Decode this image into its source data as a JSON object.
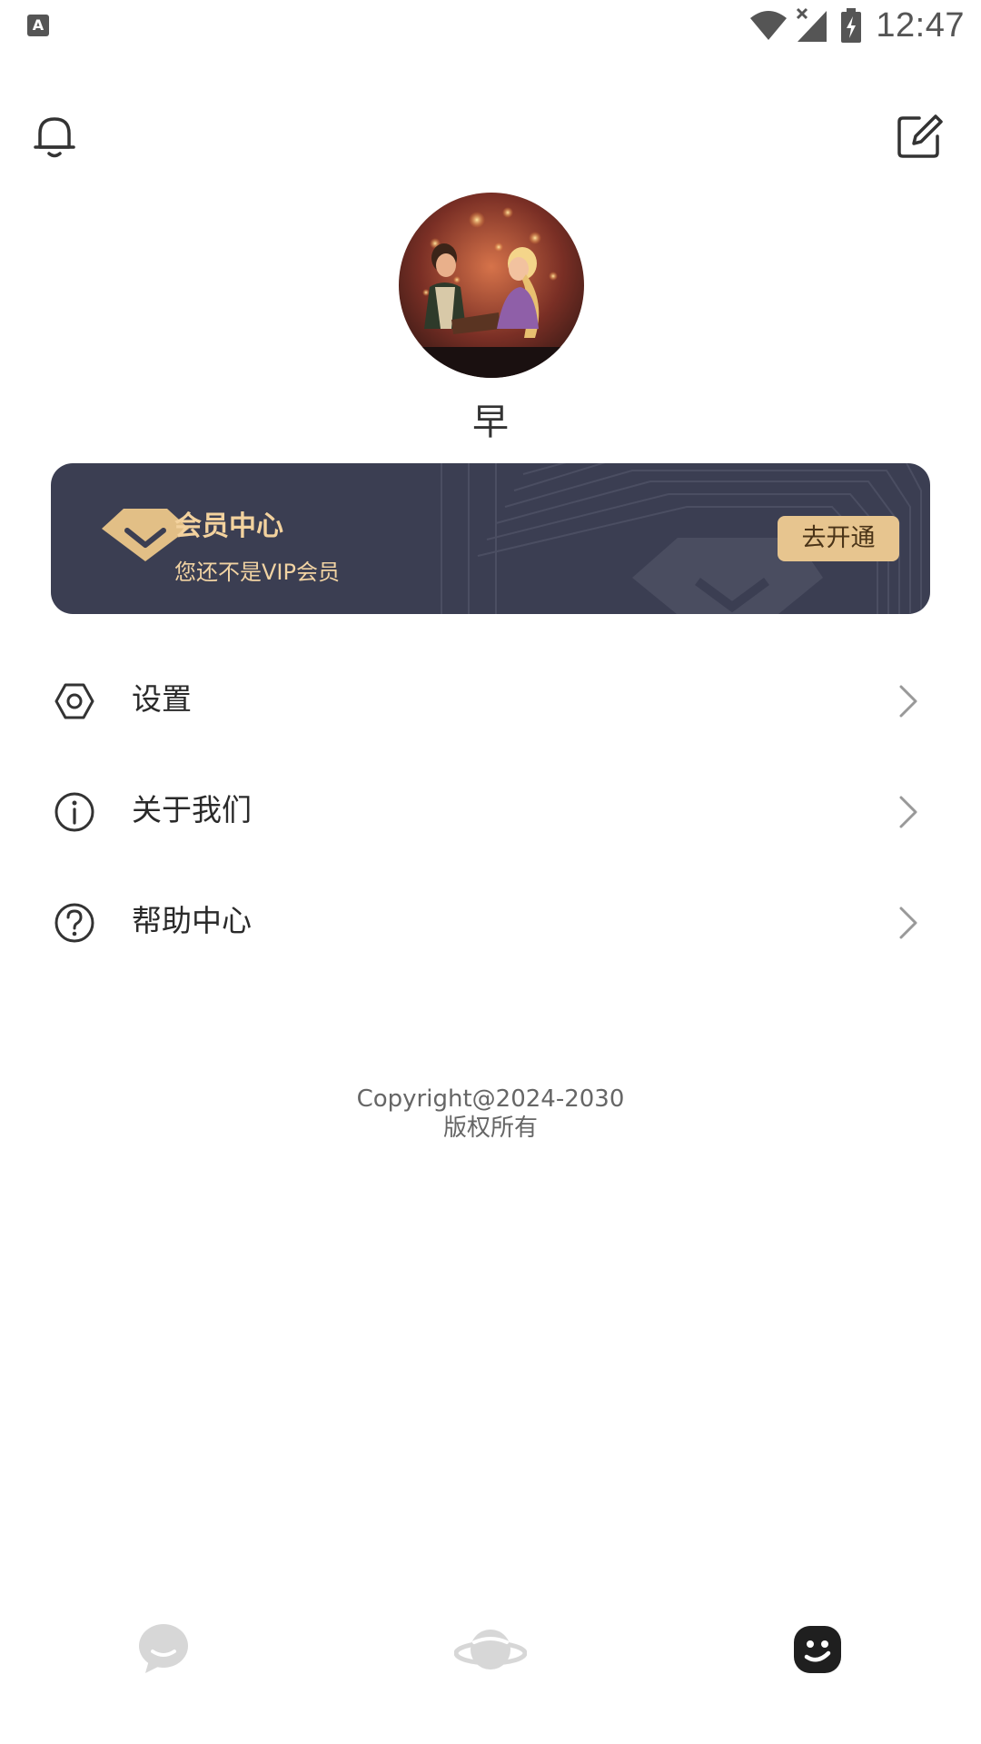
{
  "status_bar": {
    "time": "12:47",
    "left_icon_letter": "A"
  },
  "header": {
    "left_icon": "bell-icon",
    "right_icon": "edit-icon"
  },
  "profile": {
    "username": "早",
    "avatar_icon": "avatar-image"
  },
  "vip": {
    "title": "会员中心",
    "subtitle": "您还不是VIP会员",
    "button_label": "去开通",
    "accent": "#e7c58f",
    "background": "#3b3e52"
  },
  "menu": [
    {
      "label": "设置",
      "icon": "settings-icon"
    },
    {
      "label": "关于我们",
      "icon": "info-icon"
    },
    {
      "label": "帮助中心",
      "icon": "help-icon"
    }
  ],
  "copyright": {
    "line1": "Copyright@2024-2030",
    "line2": "版权所有"
  },
  "bottom_nav": [
    {
      "icon": "chat-icon",
      "active": false
    },
    {
      "icon": "planet-icon",
      "active": false
    },
    {
      "icon": "smiley-icon",
      "active": true
    }
  ]
}
